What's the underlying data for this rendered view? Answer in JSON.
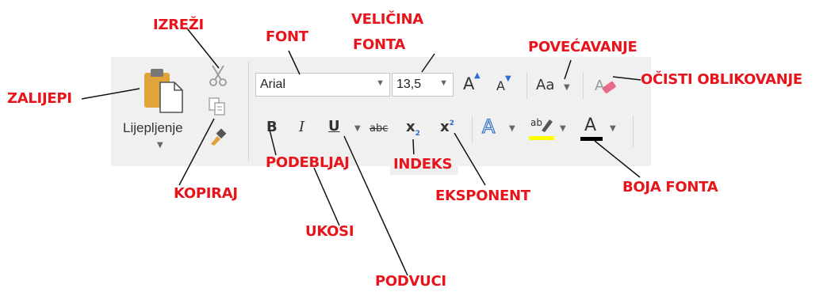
{
  "clipboard": {
    "paste_label": "Lijepljenje",
    "icons": [
      "paste-icon",
      "cut-icon",
      "copy-icon",
      "format-painter-icon"
    ]
  },
  "font": {
    "name": "Arial",
    "size": "13,5",
    "bold": "B",
    "italic": "I",
    "underline": "U",
    "strikethrough": "abc",
    "subscript": "x",
    "subscript_mark": "2",
    "superscript": "x",
    "superscript_mark": "2",
    "change_case": "Aa",
    "grow_font": "A",
    "shrink_font": "A",
    "font_color_letter": "A",
    "highlight_letters": "ab",
    "text_effects_letter": "A"
  },
  "colors": {
    "callout": "#e8141c",
    "highlight_bar": "#ffff00",
    "font_color_bar": "#000000",
    "paste_icon": "#e0a43a",
    "text_effects": "#3a78c6"
  },
  "callouts": {
    "izrezi": "IZREŽI",
    "font": "FONT",
    "velicina_fonta_1": "VELIČINA",
    "velicina_fonta_2": "FONTA",
    "povecavanje": "POVEĆAVANJE",
    "zalijepi": "ZALIJEPI",
    "ocisti": "OČISTI OBLIKOVANJE",
    "podebljaj": "PODEBLJAJ",
    "indeks": "INDEKS",
    "kopiraj": "KOPIRAJ",
    "eksponent": "EKSPONENT",
    "boja_fonta": "BOJA FONTA",
    "ukosi": "UKOSI",
    "podvuci": "PODVUCI"
  }
}
